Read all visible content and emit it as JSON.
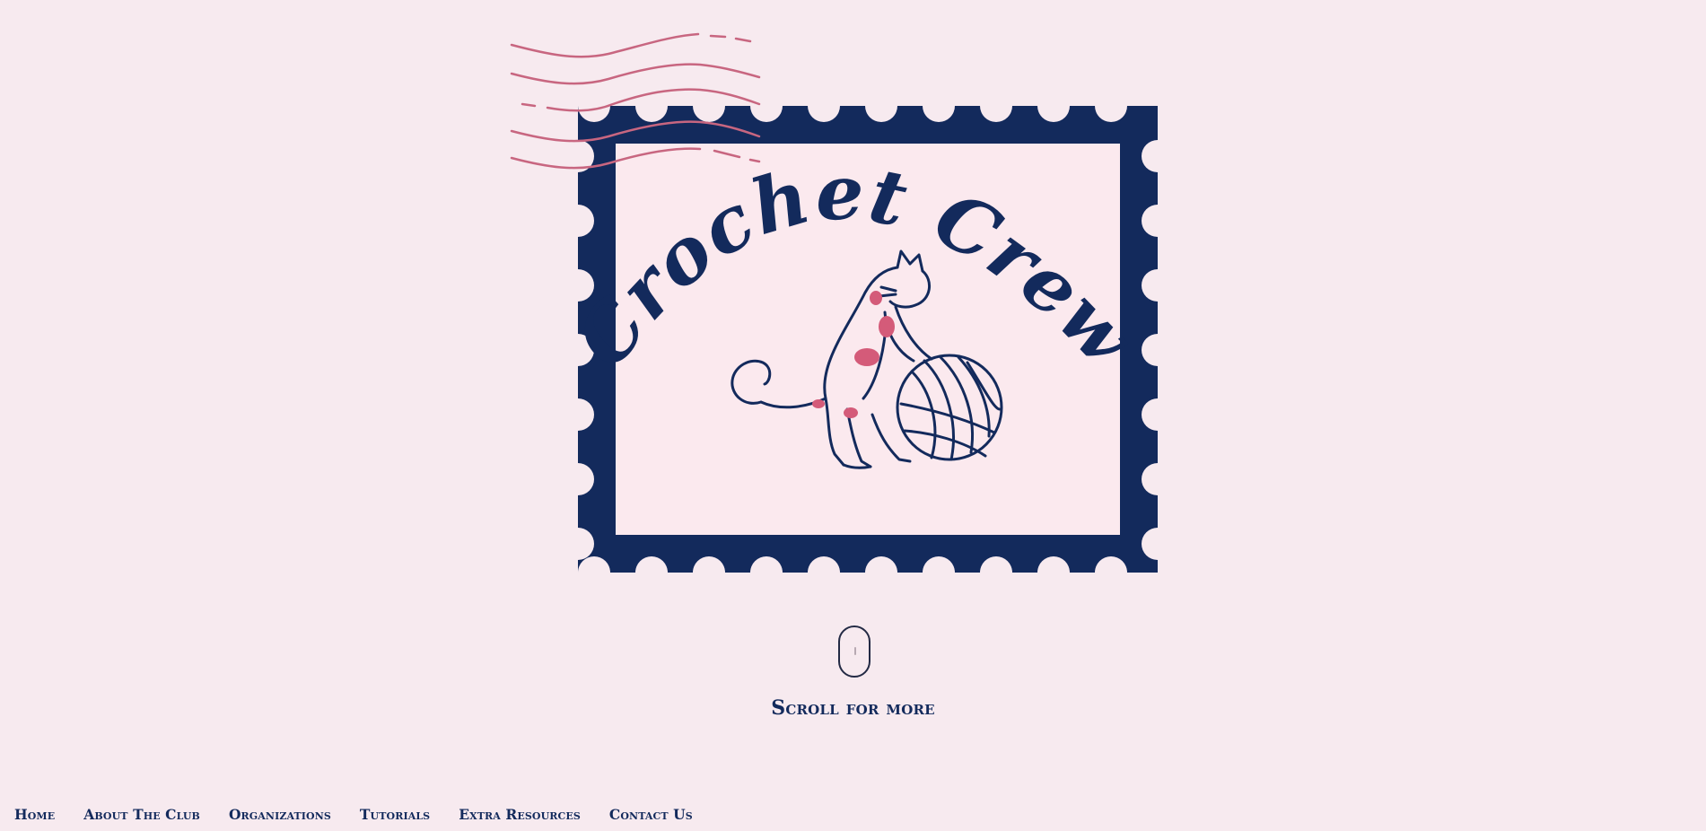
{
  "hero": {
    "logo_text": "Crochet Crew",
    "logo_icon": "cat-with-yarn-stamp",
    "colors": {
      "stamp_border": "#132a5c",
      "stamp_fill": "#fbe9ee",
      "postmark": "#c86680",
      "accent_spots": "#d45b79"
    }
  },
  "scroll": {
    "icon": "mouse-scroll-icon",
    "label": "Scroll for more"
  },
  "nav": {
    "items": [
      {
        "label": "Home"
      },
      {
        "label": "About The Club"
      },
      {
        "label": "Organizations"
      },
      {
        "label": "Tutorials"
      },
      {
        "label": "Extra Resources"
      },
      {
        "label": "Contact Us"
      }
    ]
  },
  "theme": {
    "background": "#f7eaef",
    "text": "#132a5c"
  }
}
